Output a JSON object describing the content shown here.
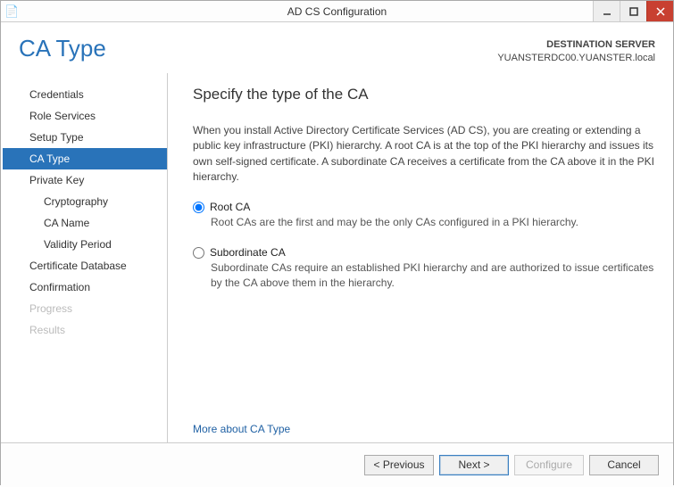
{
  "window": {
    "title": "AD CS Configuration"
  },
  "header": {
    "page_title": "CA Type",
    "dest_label": "DESTINATION SERVER",
    "dest_value": "YUANSTERDC00.YUANSTER.local"
  },
  "sidebar": {
    "items": [
      {
        "label": "Credentials",
        "sub": false,
        "state": "normal"
      },
      {
        "label": "Role Services",
        "sub": false,
        "state": "normal"
      },
      {
        "label": "Setup Type",
        "sub": false,
        "state": "normal"
      },
      {
        "label": "CA Type",
        "sub": false,
        "state": "active"
      },
      {
        "label": "Private Key",
        "sub": false,
        "state": "normal"
      },
      {
        "label": "Cryptography",
        "sub": true,
        "state": "normal"
      },
      {
        "label": "CA Name",
        "sub": true,
        "state": "normal"
      },
      {
        "label": "Validity Period",
        "sub": true,
        "state": "normal"
      },
      {
        "label": "Certificate Database",
        "sub": false,
        "state": "normal"
      },
      {
        "label": "Confirmation",
        "sub": false,
        "state": "normal"
      },
      {
        "label": "Progress",
        "sub": false,
        "state": "disabled"
      },
      {
        "label": "Results",
        "sub": false,
        "state": "disabled"
      }
    ]
  },
  "content": {
    "heading": "Specify the type of the CA",
    "intro": "When you install Active Directory Certificate Services (AD CS), you are creating or extending a public key infrastructure (PKI) hierarchy. A root CA is at the top of the PKI hierarchy and issues its own self-signed certificate. A subordinate CA receives a certificate from the CA above it in the PKI hierarchy.",
    "options": [
      {
        "label": "Root CA",
        "desc": "Root CAs are the first and may be the only CAs configured in a PKI hierarchy.",
        "selected": true
      },
      {
        "label": "Subordinate CA",
        "desc": "Subordinate CAs require an established PKI hierarchy and are authorized to issue certificates by the CA above them in the hierarchy.",
        "selected": false
      }
    ],
    "more_link": "More about CA Type"
  },
  "footer": {
    "previous": "< Previous",
    "next": "Next >",
    "configure": "Configure",
    "cancel": "Cancel"
  }
}
